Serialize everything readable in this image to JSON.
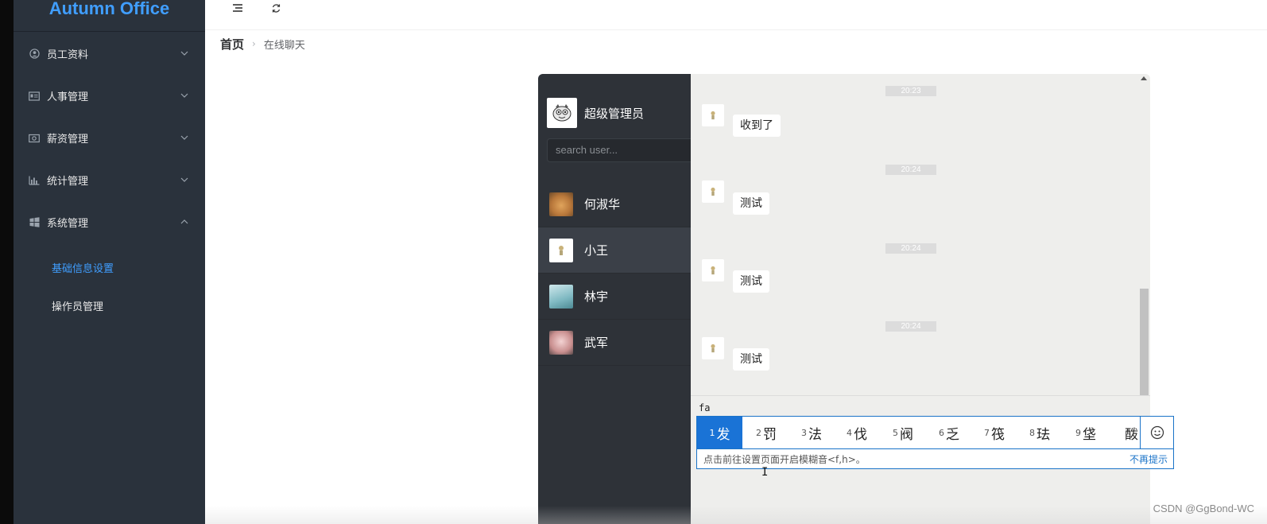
{
  "app": {
    "title": "Autumn Office"
  },
  "sidebar": {
    "menus": [
      {
        "label": "员工资料",
        "icon": "user-circle-icon",
        "expanded": false
      },
      {
        "label": "人事管理",
        "icon": "id-card-icon",
        "expanded": false
      },
      {
        "label": "薪资管理",
        "icon": "money-icon",
        "expanded": false
      },
      {
        "label": "统计管理",
        "icon": "bar-chart-icon",
        "expanded": false
      },
      {
        "label": "系统管理",
        "icon": "windows-icon",
        "expanded": true
      }
    ],
    "submenus": [
      {
        "label": "基础信息设置",
        "active": true
      },
      {
        "label": "操作员管理",
        "active": false
      }
    ]
  },
  "topbar": {
    "menu_icon": "hamburger-icon",
    "refresh_icon": "refresh-icon"
  },
  "breadcrumb": {
    "home": "首页",
    "current": "在线聊天"
  },
  "chat": {
    "current_user": {
      "name": "超级管理员",
      "avatar": "cartoon-avatar"
    },
    "search_placeholder": "search user...",
    "contacts": [
      {
        "name": "何淑华",
        "avatar": "dog-avatar",
        "active": false
      },
      {
        "name": "小王",
        "avatar": "default-avatar",
        "active": true
      },
      {
        "name": "林宇",
        "avatar": "anime-avatar",
        "active": false
      },
      {
        "name": "武军",
        "avatar": "girl-avatar",
        "active": false
      }
    ],
    "messages": [
      {
        "time": "20:23",
        "text": "收到了"
      },
      {
        "time": "20:24",
        "text": "测试"
      },
      {
        "time": "20:24",
        "text": "测试"
      },
      {
        "time": "20:24",
        "text": "测试"
      }
    ],
    "input_text": "fa"
  },
  "ime": {
    "candidates": [
      {
        "num": "1",
        "text": "发"
      },
      {
        "num": "2",
        "text": "罚"
      },
      {
        "num": "3",
        "text": "法"
      },
      {
        "num": "4",
        "text": "伐"
      },
      {
        "num": "5",
        "text": "阀"
      },
      {
        "num": "6",
        "text": "乏"
      },
      {
        "num": "7",
        "text": "筏"
      },
      {
        "num": "8",
        "text": "珐"
      },
      {
        "num": "9",
        "text": "垡"
      },
      {
        "num": "",
        "text": "酦"
      }
    ],
    "hint": "点击前往设置页面开启模糊音<f,h>。",
    "dismiss": "不再提示",
    "emoji_icon": "smiley-icon"
  },
  "watermark": "CSDN @GgBond-WC",
  "colors": {
    "accent": "#409eff",
    "sidebar_bg": "#2a323c",
    "chat_sidebar_bg": "#2e3238",
    "ime_blue": "#1a73d6"
  }
}
